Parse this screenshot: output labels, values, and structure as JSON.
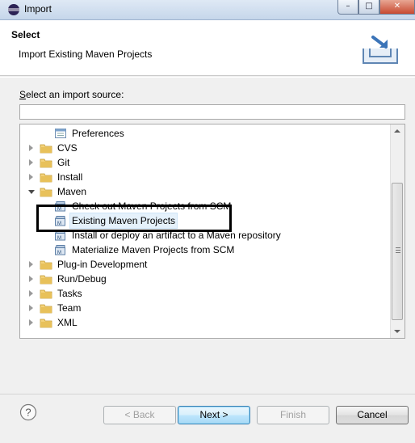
{
  "window": {
    "title": "Import",
    "controls": {
      "minimize": "–",
      "maximize": "□",
      "close": "✕"
    }
  },
  "banner": {
    "title": "Select",
    "description": "Import Existing Maven Projects",
    "icon": "import-wizard-icon"
  },
  "source": {
    "label_prefix": "S",
    "label_rest": "elect an import source:",
    "filter_value": ""
  },
  "tree": {
    "items": [
      {
        "label": "Preferences",
        "level": 1,
        "icon": "preferences-icon",
        "expandable": false
      },
      {
        "label": "CVS",
        "level": 0,
        "icon": "folder-icon",
        "expandable": true,
        "expanded": false
      },
      {
        "label": "Git",
        "level": 0,
        "icon": "folder-icon",
        "expandable": true,
        "expanded": false
      },
      {
        "label": "Install",
        "level": 0,
        "icon": "folder-icon",
        "expandable": true,
        "expanded": false
      },
      {
        "label": "Maven",
        "level": 0,
        "icon": "folder-icon",
        "expandable": true,
        "expanded": true
      },
      {
        "label": "Check out Maven Projects from SCM",
        "level": 1,
        "icon": "maven-icon",
        "expandable": false
      },
      {
        "label": "Existing Maven Projects",
        "level": 1,
        "icon": "maven-icon",
        "expandable": false,
        "selected": true
      },
      {
        "label": "Install or deploy an artifact to a Maven repository",
        "level": 1,
        "icon": "maven-icon",
        "expandable": false
      },
      {
        "label": "Materialize Maven Projects from SCM",
        "level": 1,
        "icon": "maven-icon",
        "expandable": false
      },
      {
        "label": "Plug-in Development",
        "level": 0,
        "icon": "folder-icon",
        "expandable": true,
        "expanded": false
      },
      {
        "label": "Run/Debug",
        "level": 0,
        "icon": "folder-icon",
        "expandable": true,
        "expanded": false
      },
      {
        "label": "Tasks",
        "level": 0,
        "icon": "folder-icon",
        "expandable": true,
        "expanded": false
      },
      {
        "label": "Team",
        "level": 0,
        "icon": "folder-icon",
        "expandable": true,
        "expanded": false
      },
      {
        "label": "XML",
        "level": 0,
        "icon": "folder-icon",
        "expandable": true,
        "expanded": false
      }
    ]
  },
  "buttons": {
    "help": "?",
    "back": "< Back",
    "next": "Next >",
    "finish": "Finish",
    "cancel": "Cancel"
  },
  "colors": {
    "folder": "#e8c15a",
    "selection": "#e5f1fb",
    "default_button_border": "#3c7fb1"
  }
}
